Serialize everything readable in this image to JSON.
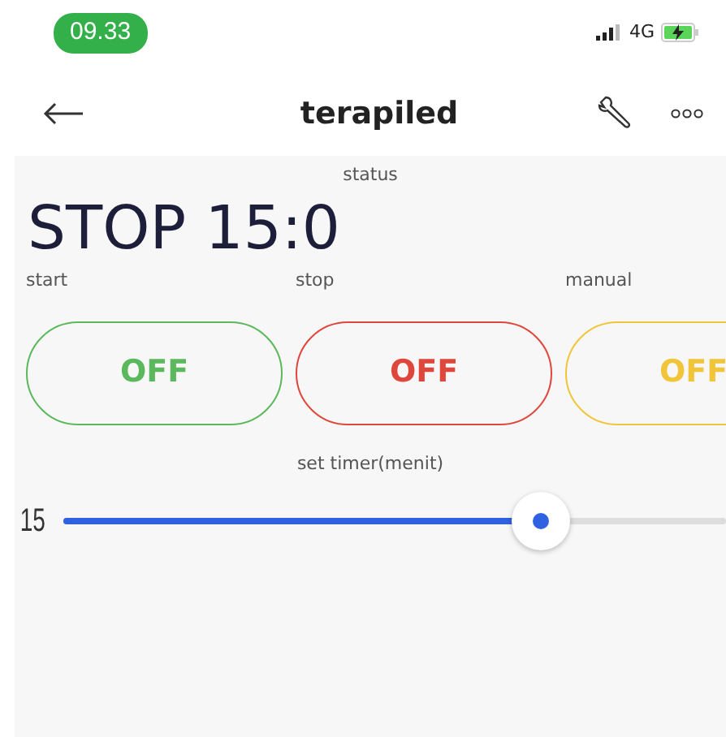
{
  "status_bar": {
    "time": "09.33",
    "network": "4G"
  },
  "header": {
    "title": "terapiled"
  },
  "status": {
    "label": "status",
    "value": "STOP 15:0"
  },
  "switches": [
    {
      "label": "start",
      "state": "OFF",
      "color": "#5cb85c"
    },
    {
      "label": "stop",
      "state": "OFF",
      "color": "#e0473c"
    },
    {
      "label": "manual",
      "state": "OFF",
      "color": "#f0c53a"
    }
  ],
  "timer": {
    "label": "set timer(menit)",
    "value": "15",
    "level": 0.72
  }
}
